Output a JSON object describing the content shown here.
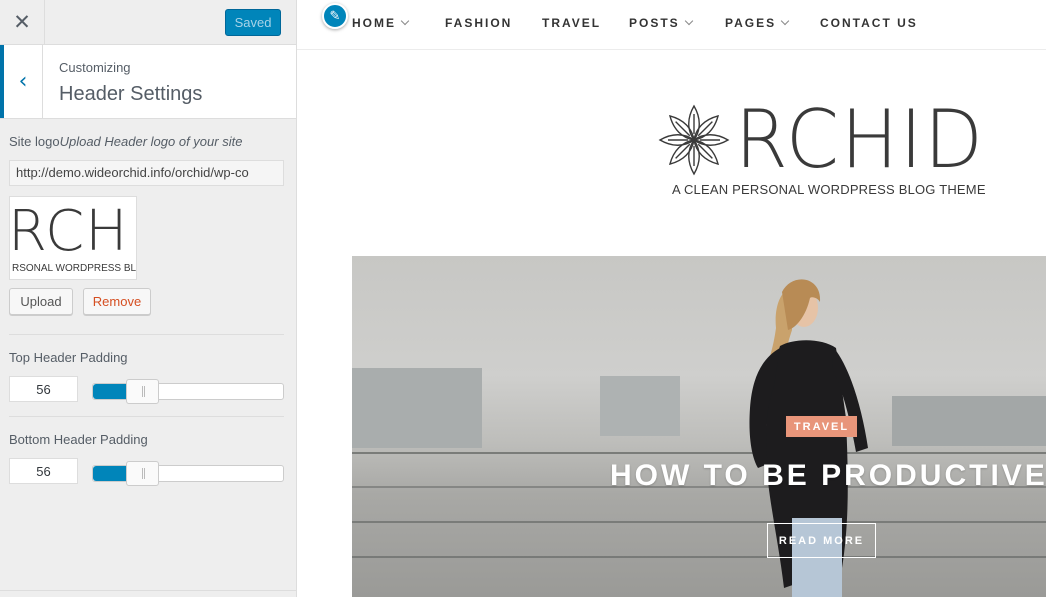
{
  "sidebar": {
    "close_icon": "✕",
    "saved_label": "Saved",
    "back_icon": "‹",
    "crumb": "Customizing",
    "section_title": "Header Settings",
    "site_logo": {
      "label": "Site logo",
      "description": "Upload Header logo of your site",
      "url": "http://demo.wideorchid.info/orchid/wp-co",
      "thumb_big": "RCH",
      "thumb_small": "RSONAL WORDPRESS BL",
      "upload_label": "Upload",
      "remove_label": "Remove"
    },
    "top_padding": {
      "label": "Top Header Padding",
      "value": "56",
      "level": 0.2
    },
    "bottom_padding": {
      "label": "Bottom Header Padding",
      "value": "56",
      "level": 0.2
    }
  },
  "preview": {
    "nav": [
      {
        "label": "HOME",
        "dropdown": true
      },
      {
        "label": "FASHION",
        "dropdown": false
      },
      {
        "label": "TRAVEL",
        "dropdown": false
      },
      {
        "label": "POSTS",
        "dropdown": true
      },
      {
        "label": "PAGES",
        "dropdown": true
      },
      {
        "label": "CONTACT US",
        "dropdown": false
      }
    ],
    "edit_icon": "✎",
    "logo": {
      "text": "RCHID",
      "tagline": "A CLEAN PERSONAL WORDPRESS BLOG THEME"
    },
    "hero": {
      "category": "TRAVEL",
      "title": "HOW TO BE PRODUCTIVE",
      "button": "READ MORE"
    }
  },
  "colors": {
    "accent": "#0085ba",
    "category_badge": "#e8957a",
    "remove_text": "#d54e21"
  }
}
